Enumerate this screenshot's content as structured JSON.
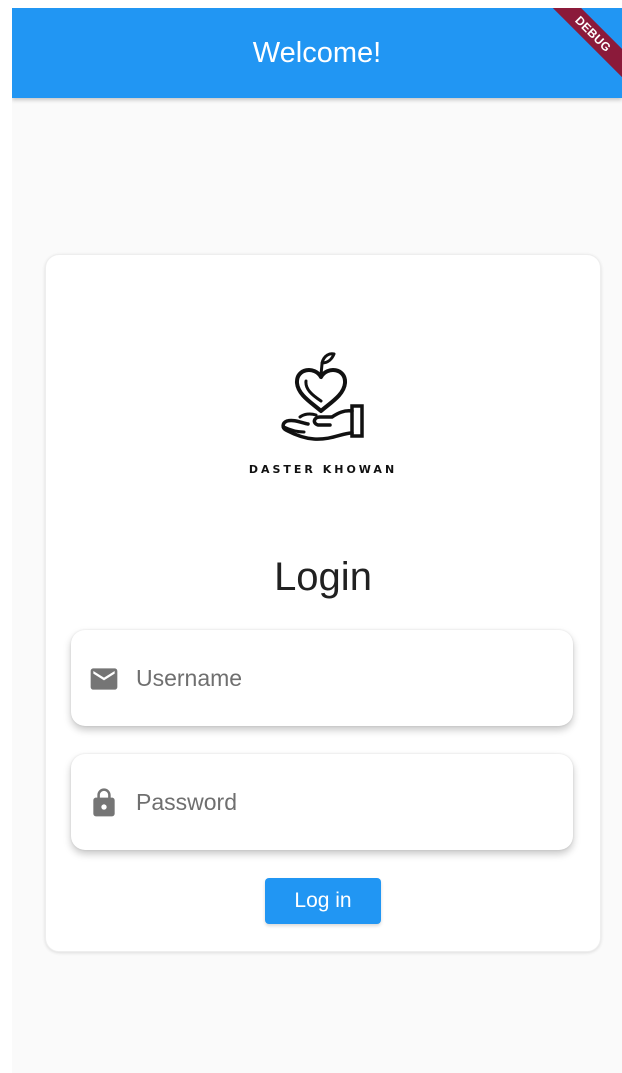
{
  "appbar": {
    "title": "Welcome!",
    "color": "#2196f3",
    "debug_banner": "DEBUG"
  },
  "logo": {
    "icon": "heart-in-hand-icon",
    "brand_text": "DASTER KHOWAN"
  },
  "login": {
    "title": "Login",
    "username": {
      "icon": "mail-icon",
      "placeholder": "Username",
      "value": ""
    },
    "password": {
      "icon": "lock-icon",
      "placeholder": "Password",
      "value": ""
    },
    "button_label": "Log in",
    "button_color": "#2196f3"
  }
}
